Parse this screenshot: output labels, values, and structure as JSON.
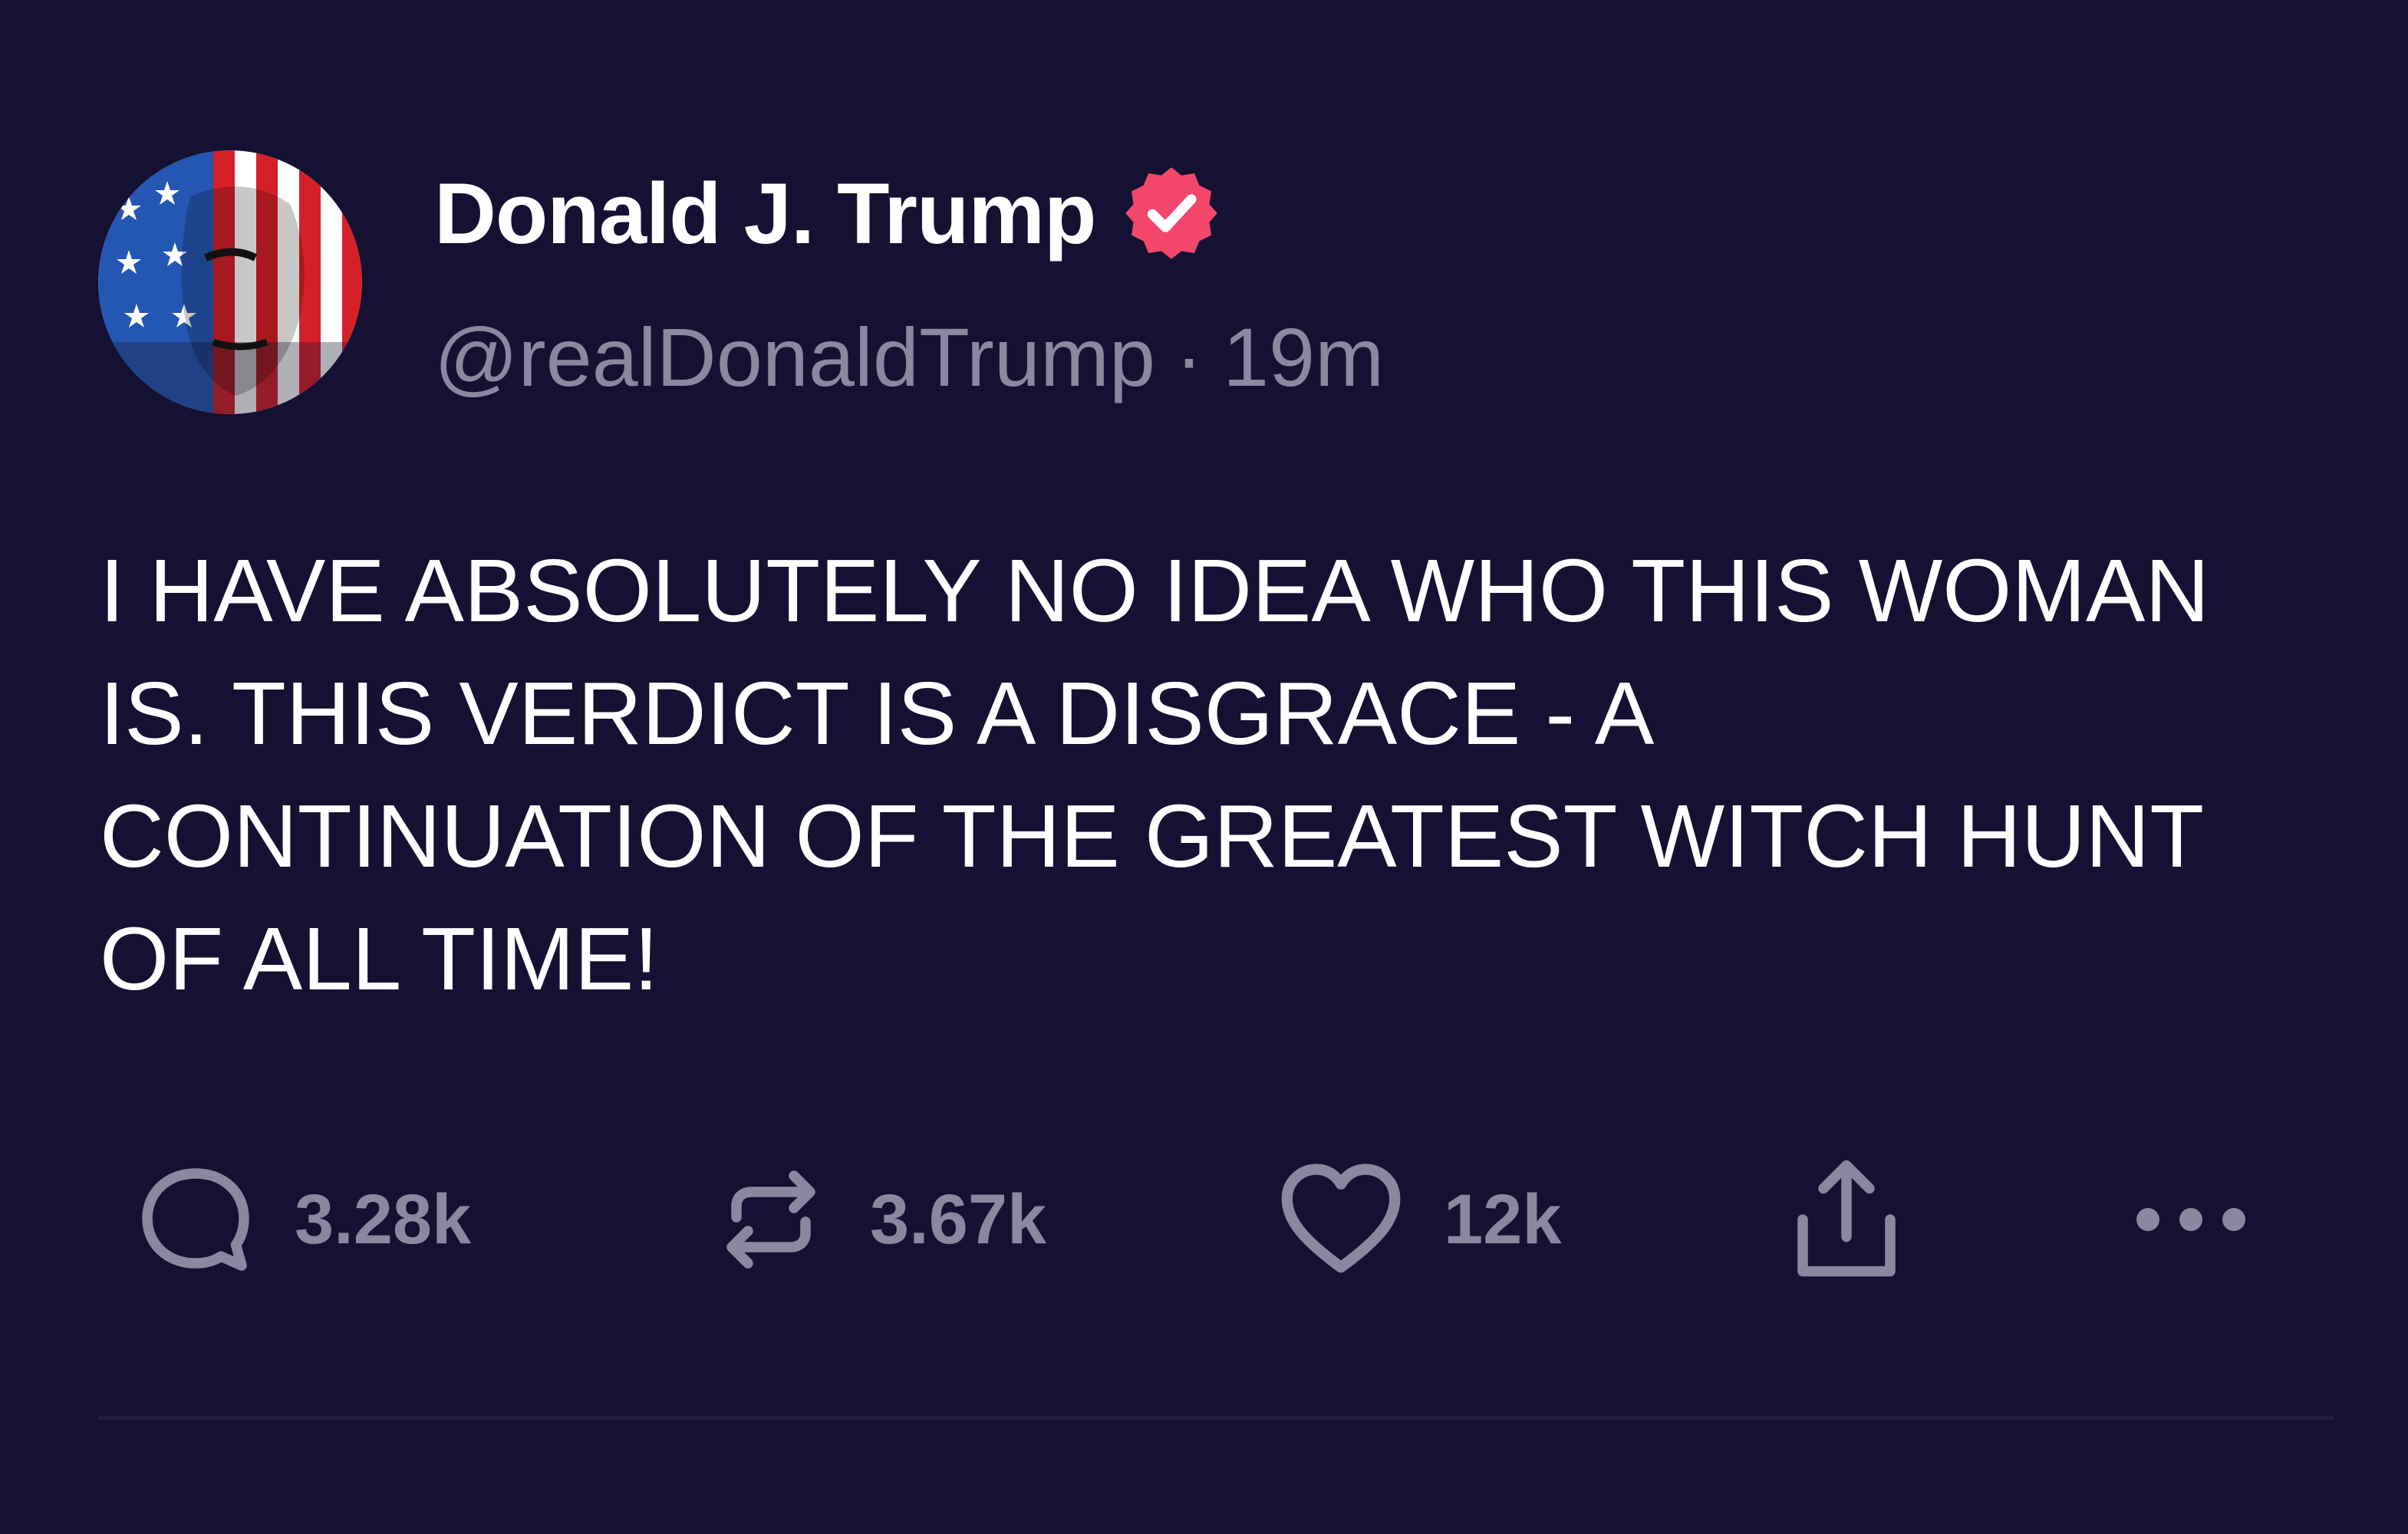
{
  "post": {
    "author": {
      "display_name": "Donald J. Trump",
      "handle": "@realDonaldTrump",
      "verified": true
    },
    "separator": "·",
    "time_ago": "19m",
    "text_lines": [
      "I HAVE ABSOLUTELY NO IDEA WHO THIS WOMAN",
      "IS. THIS VERDICT IS A DISGRACE - A",
      "CONTINUATION OF THE GREATEST WITCH HUNT",
      "OF ALL TIME!"
    ],
    "actions": {
      "replies": "3.28k",
      "reposts": "3.67k",
      "likes": "12k"
    }
  },
  "icons": {
    "verified": "verified-badge-icon",
    "reply": "comment-bubble-icon",
    "repost": "repost-arrows-icon",
    "like": "heart-icon",
    "share": "share-upload-icon",
    "more": "more-dots-icon"
  },
  "colors": {
    "background": "#141132",
    "primary_text": "#ffffff",
    "secondary_text": "#8a87a0",
    "verified_badge": "#f2476b",
    "divider": "#221f40"
  }
}
